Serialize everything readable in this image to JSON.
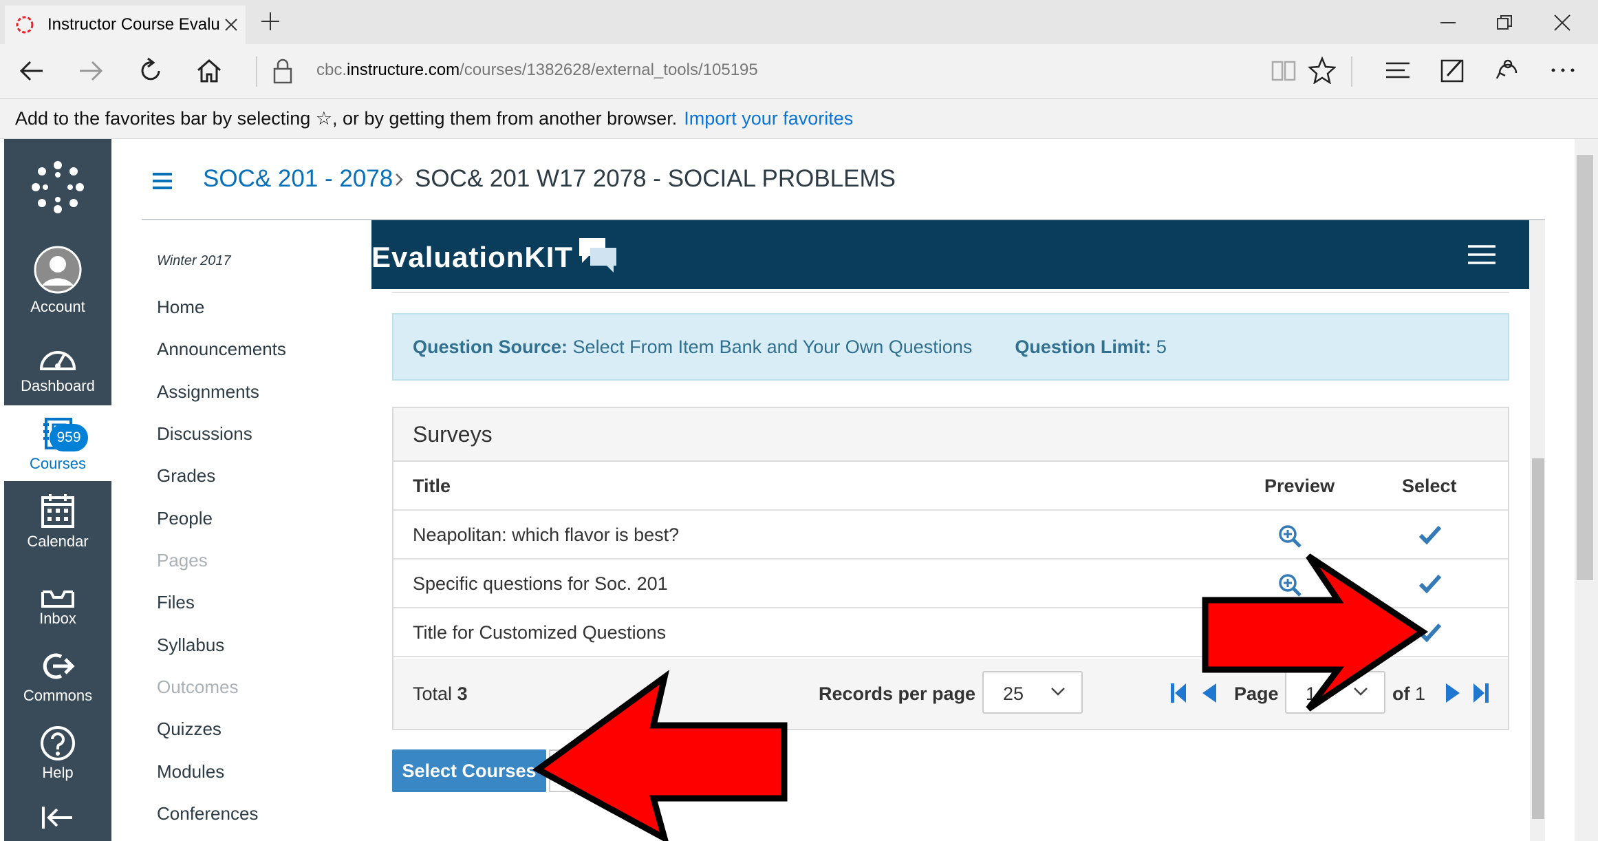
{
  "browser": {
    "tab_title": "Instructor Course Evalua",
    "url_prefix": "cbc.",
    "url_host": "instructure.com",
    "url_path": "/courses/1382628/external_tools/105195",
    "favorites_message": "Add to the favorites bar by selecting ☆, or by getting them from another browser.",
    "favorites_link": "Import your favorites"
  },
  "global_nav": [
    {
      "label": "Account",
      "icon": "avatar-icon"
    },
    {
      "label": "Dashboard",
      "icon": "dashboard-icon"
    },
    {
      "label": "Courses",
      "icon": "courses-icon",
      "active": true
    },
    {
      "label": "Calendar",
      "icon": "calendar-icon"
    },
    {
      "label": "Inbox",
      "icon": "inbox-icon",
      "badge": "959"
    },
    {
      "label": "Commons",
      "icon": "commons-icon"
    },
    {
      "label": "Help",
      "icon": "help-icon"
    }
  ],
  "breadcrumb": {
    "course_link": "SOC& 201 - 2078",
    "current": "SOC& 201 W17 2078 - SOCIAL PROBLEMS"
  },
  "course_nav": {
    "term": "Winter 2017",
    "items": [
      {
        "label": "Home",
        "disabled": false
      },
      {
        "label": "Announcements",
        "disabled": false
      },
      {
        "label": "Assignments",
        "disabled": false
      },
      {
        "label": "Discussions",
        "disabled": false
      },
      {
        "label": "Grades",
        "disabled": false
      },
      {
        "label": "People",
        "disabled": false
      },
      {
        "label": "Pages",
        "disabled": true
      },
      {
        "label": "Files",
        "disabled": false
      },
      {
        "label": "Syllabus",
        "disabled": false
      },
      {
        "label": "Outcomes",
        "disabled": true
      },
      {
        "label": "Quizzes",
        "disabled": false
      },
      {
        "label": "Modules",
        "disabled": false
      },
      {
        "label": "Conferences",
        "disabled": false
      }
    ]
  },
  "evalkit": {
    "logo": "EvaluationKIT",
    "question_source_label": "Question Source:",
    "question_source_value": "Select From Item Bank and Your Own Questions",
    "question_limit_label": "Question Limit:",
    "question_limit_value": "5",
    "surveys_title": "Surveys",
    "columns": {
      "title": "Title",
      "preview": "Preview",
      "select": "Select"
    },
    "rows": [
      {
        "title": "Neapolitan: which flavor is best?"
      },
      {
        "title": "Specific questions for Soc. 201"
      },
      {
        "title": "Title for Customized Questions"
      }
    ],
    "total_label": "Total",
    "total_value": "3",
    "records_per_page_label": "Records per page",
    "records_per_page_value": "25",
    "page_label": "Page",
    "page_value": "1",
    "of_label": "of",
    "of_value": "1",
    "select_courses_button": "Select Courses"
  },
  "colors": {
    "canvas_nav": "#394b58",
    "evalkit_header": "#0a3d5c",
    "link_blue": "#337ab7",
    "annotation_arrow": "#ff0000"
  }
}
